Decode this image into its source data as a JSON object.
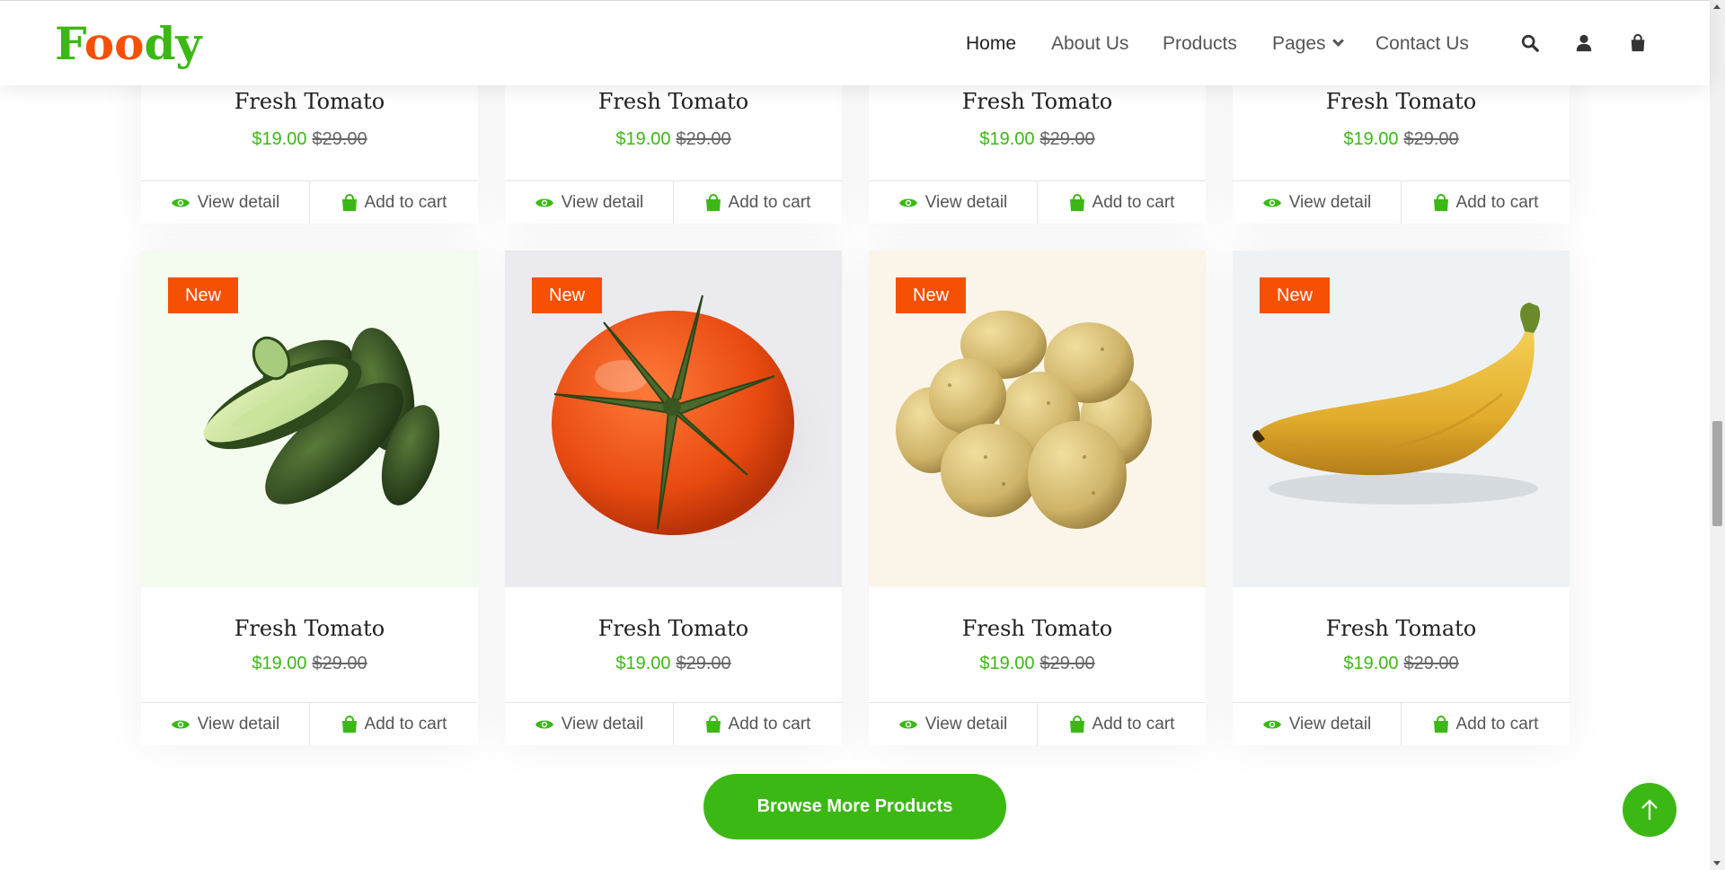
{
  "brand": {
    "logo_text": "Foody"
  },
  "nav": {
    "items": [
      {
        "label": "Home"
      },
      {
        "label": "About Us"
      },
      {
        "label": "Products"
      },
      {
        "label": "Pages"
      },
      {
        "label": "Contact Us"
      }
    ],
    "icons": [
      "search-icon",
      "user-icon",
      "shopping-bag-icon"
    ]
  },
  "products": {
    "badge_label": "New",
    "view_detail_label": "View detail",
    "add_to_cart_label": "Add to cart",
    "items": [
      {
        "title": "Fresh Tomato",
        "price": "$19.00",
        "old_price": "$29.00"
      },
      {
        "title": "Fresh Tomato",
        "price": "$19.00",
        "old_price": "$29.00"
      },
      {
        "title": "Fresh Tomato",
        "price": "$19.00",
        "old_price": "$29.00"
      },
      {
        "title": "Fresh Tomato",
        "price": "$19.00",
        "old_price": "$29.00"
      },
      {
        "title": "Fresh Tomato",
        "price": "$19.00",
        "old_price": "$29.00",
        "badge": "New",
        "image": "cucumber"
      },
      {
        "title": "Fresh Tomato",
        "price": "$19.00",
        "old_price": "$29.00",
        "badge": "New",
        "image": "tomato"
      },
      {
        "title": "Fresh Tomato",
        "price": "$19.00",
        "old_price": "$29.00",
        "badge": "New",
        "image": "potato"
      },
      {
        "title": "Fresh Tomato",
        "price": "$19.00",
        "old_price": "$29.00",
        "badge": "New",
        "image": "banana"
      }
    ]
  },
  "browse_button": {
    "label": "Browse More Products"
  },
  "colors": {
    "primary": "#3cb815",
    "secondary": "#f65005"
  }
}
